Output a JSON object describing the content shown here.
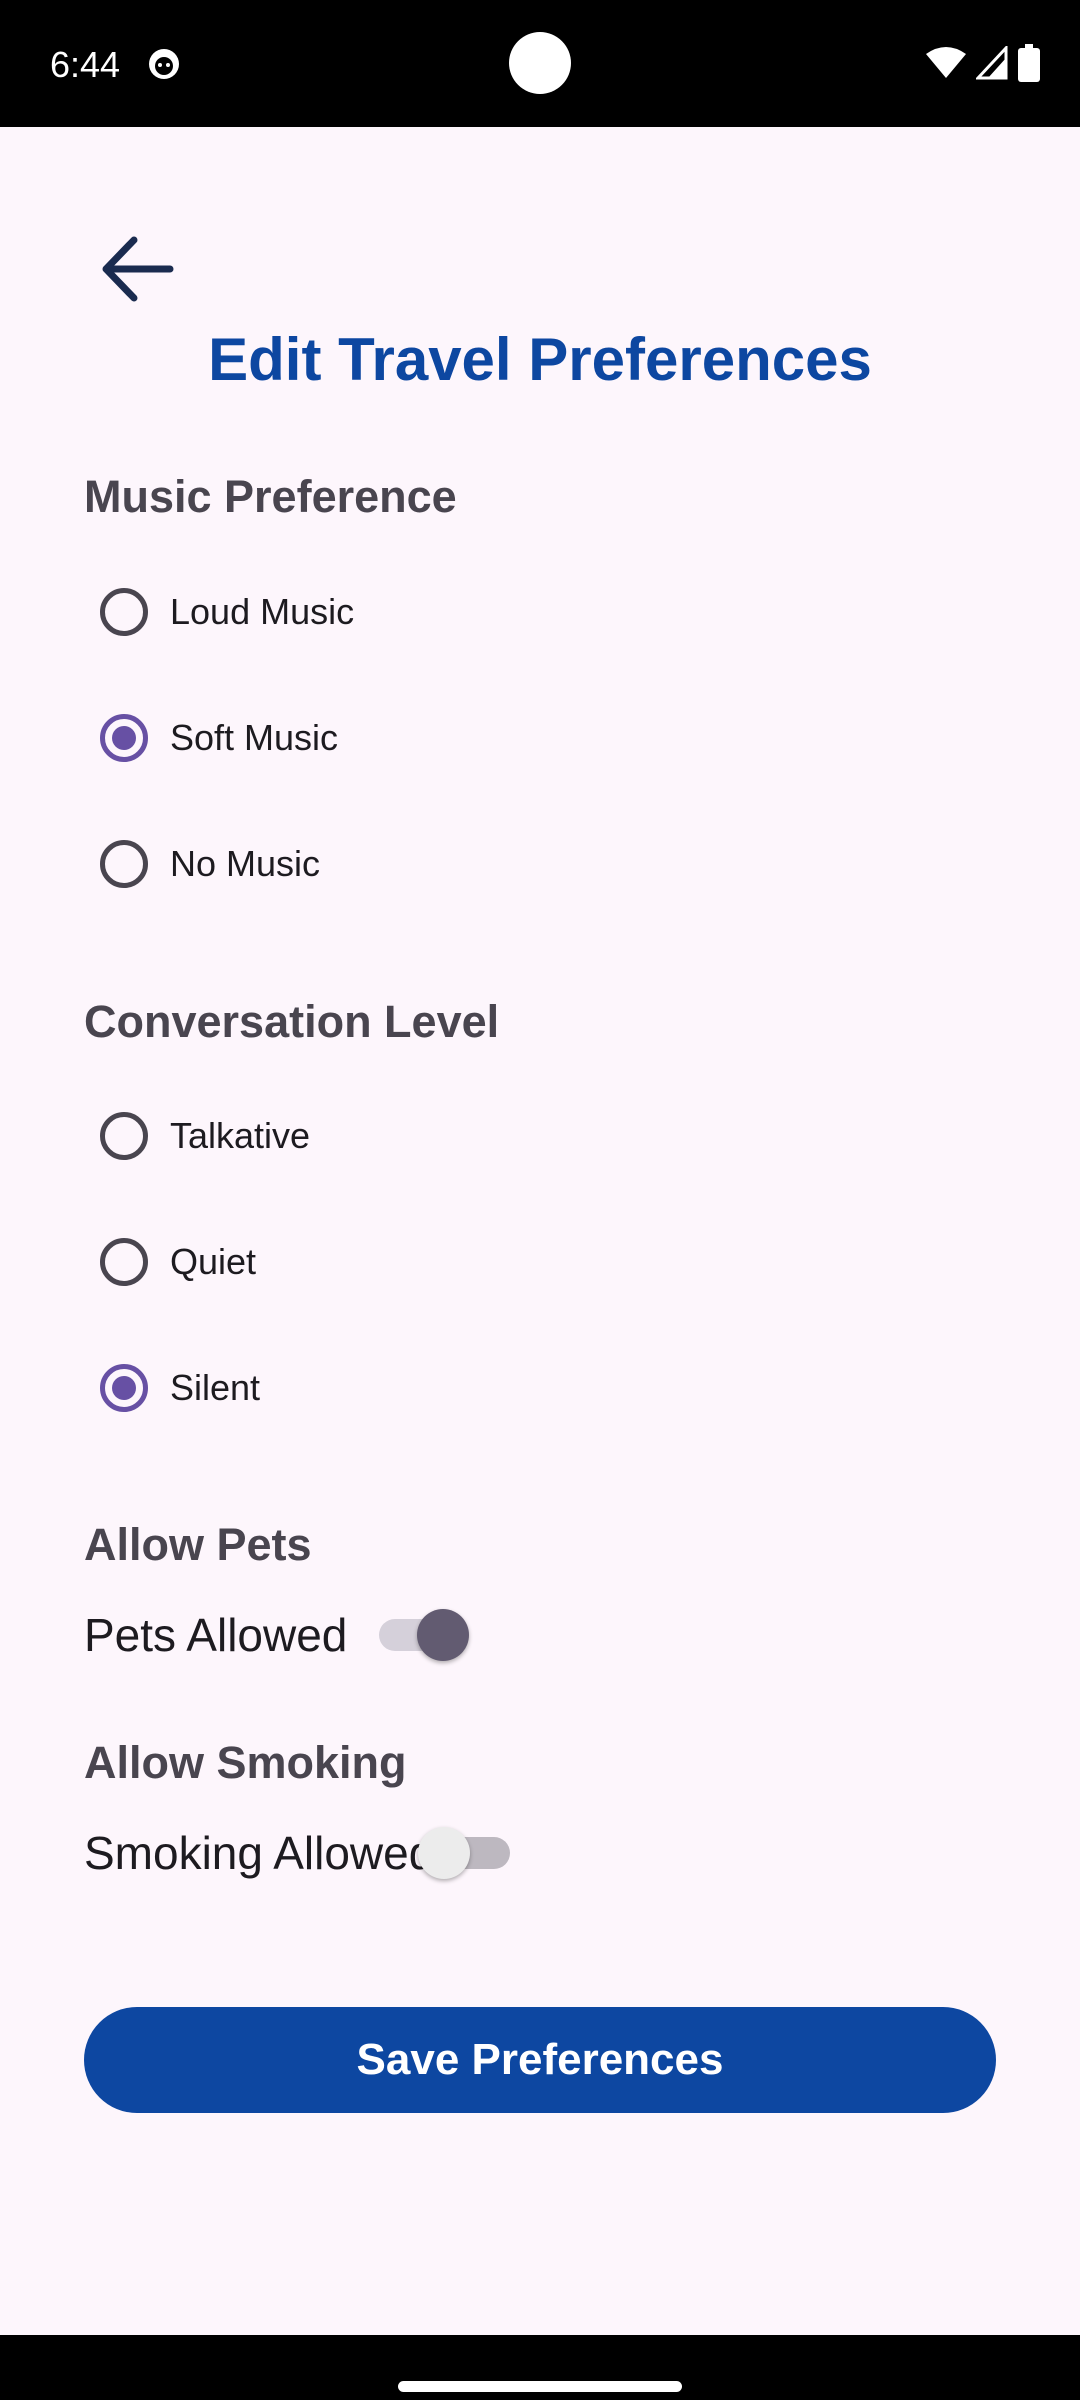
{
  "status_bar": {
    "time": "6:44",
    "icons": [
      "app-notification-icon",
      "wifi-icon",
      "cellular-signal-icon",
      "battery-icon"
    ]
  },
  "header": {
    "back_icon": "arrow-back-icon",
    "title": "Edit Travel Preferences"
  },
  "music": {
    "title": "Music Preference",
    "options": [
      "Loud Music",
      "Soft Music",
      "No Music"
    ],
    "selected": "Soft Music"
  },
  "conversation": {
    "title": "Conversation Level",
    "options": [
      "Talkative",
      "Quiet",
      "Silent"
    ],
    "selected": "Silent"
  },
  "pets": {
    "title": "Allow Pets",
    "switch_label": "Pets Allowed",
    "enabled": true
  },
  "smoking": {
    "title": "Allow Smoking",
    "switch_label": "Smoking Allowed",
    "enabled": false
  },
  "save_button_label": "Save Preferences",
  "colors": {
    "accent": "#0d47a1",
    "radio_selected": "#6750a4",
    "background": "#fdf6fc",
    "section_title": "#49454f"
  }
}
